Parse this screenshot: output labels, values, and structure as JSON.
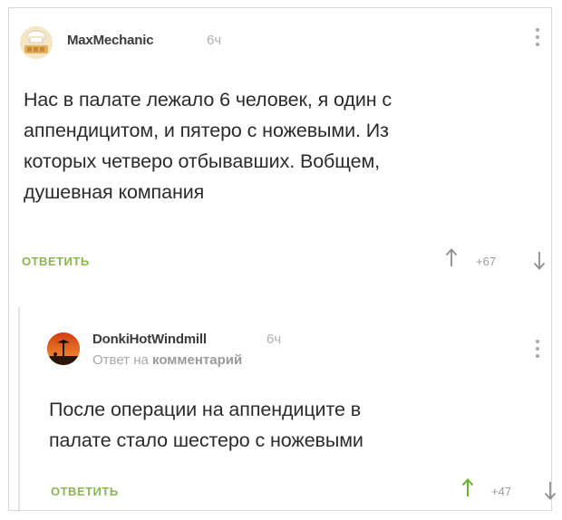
{
  "comments": [
    {
      "author": "MaxMechanic",
      "time": "6ч",
      "text_lines": [
        "Нас в палате лежало 6 человек, я один с",
        "аппендицитом, и пятеро с ножевыми. Из",
        "которых четверо отбывавших. Вобщем,",
        "душевная компания"
      ],
      "reply_label": "ОТВЕТИТЬ",
      "rating": "+67",
      "accent_color": "#8ab655"
    },
    {
      "author": "DonkiHotWindmill",
      "time": "6ч",
      "reply_to_prefix": "Ответ на",
      "reply_to_target": "комментарий",
      "text_lines": [
        "После операции на аппендиците в",
        "палате стало шестеро с ножевыми"
      ],
      "reply_label": "ОТВЕТИТЬ",
      "rating": "+47",
      "up_color_active": "#69b22c"
    }
  ],
  "icons": {
    "vote_up": "arrow-up-icon",
    "vote_down": "arrow-down-icon",
    "menu": "more-vertical-icon"
  }
}
